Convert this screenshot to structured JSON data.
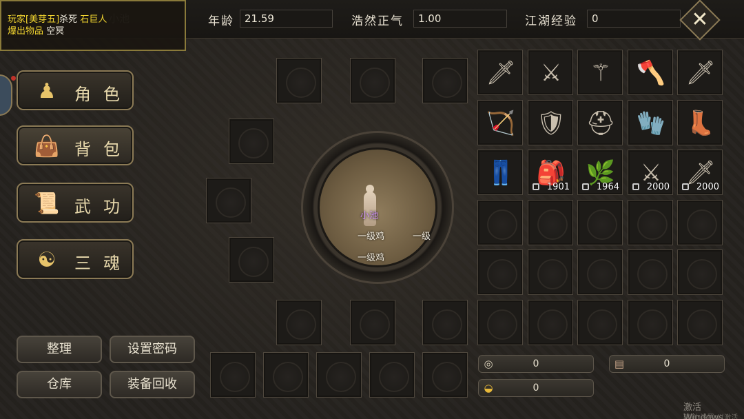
{
  "notice": {
    "prefix": "玩家",
    "player": "[美芽五]",
    "action": "杀死",
    "target": "石巨人",
    "line2_label": "爆出物品",
    "line2_value": "空冥",
    "ghost_name": "小池"
  },
  "stats": [
    {
      "label": "年龄",
      "value": "21.59"
    },
    {
      "label": "浩然正气",
      "value": "1.00"
    },
    {
      "label": "江湖经验",
      "value": "0"
    }
  ],
  "close_label": "✕",
  "menu": [
    {
      "label": "角色",
      "icon": "character-icon",
      "glyph": "♟"
    },
    {
      "label": "背包",
      "icon": "bag-icon",
      "glyph": "👜"
    },
    {
      "label": "武功",
      "icon": "scroll-icon",
      "glyph": "📜"
    },
    {
      "label": "三魂",
      "icon": "soul-icon",
      "glyph": "☯"
    }
  ],
  "actions": {
    "sort": "整理",
    "set_password": "设置密码",
    "warehouse": "仓库",
    "recycle": "装备回收"
  },
  "map": {
    "player_name": "小池",
    "mob_label": "一级鸡",
    "mob_label_partial": "一级"
  },
  "inventory": [
    {
      "icon": "dagger-icon",
      "glyph": "🗡"
    },
    {
      "icon": "sword-icon",
      "glyph": "⚔"
    },
    {
      "icon": "halberd-icon",
      "glyph": "⚚"
    },
    {
      "icon": "axe-icon",
      "glyph": "🪓"
    },
    {
      "icon": "blade-icon",
      "glyph": "🗡"
    },
    {
      "icon": "bow-icon",
      "glyph": "🏹"
    },
    {
      "icon": "armor-icon",
      "glyph": "🛡"
    },
    {
      "icon": "helmet-icon",
      "glyph": "⛑"
    },
    {
      "icon": "bracers-icon",
      "glyph": "🧤"
    },
    {
      "icon": "boots-icon",
      "glyph": "👢"
    },
    {
      "icon": "pants-icon",
      "glyph": "👖"
    },
    {
      "icon": "bag-item-icon",
      "glyph": "🎒",
      "count": "1901",
      "locked": true
    },
    {
      "icon": "herb-icon",
      "glyph": "🌿",
      "count": "1964",
      "locked": true
    },
    {
      "icon": "spear-item-icon",
      "glyph": "⚔",
      "count": "2000",
      "locked": true
    },
    {
      "icon": "sword-item-icon",
      "glyph": "🗡",
      "count": "2000",
      "locked": true
    }
  ],
  "currency": {
    "coins": "0",
    "gold": "0",
    "token": "0"
  },
  "watermark": {
    "line1": "激活 Windows",
    "line2": "转到\"设置\"以激活 W"
  }
}
